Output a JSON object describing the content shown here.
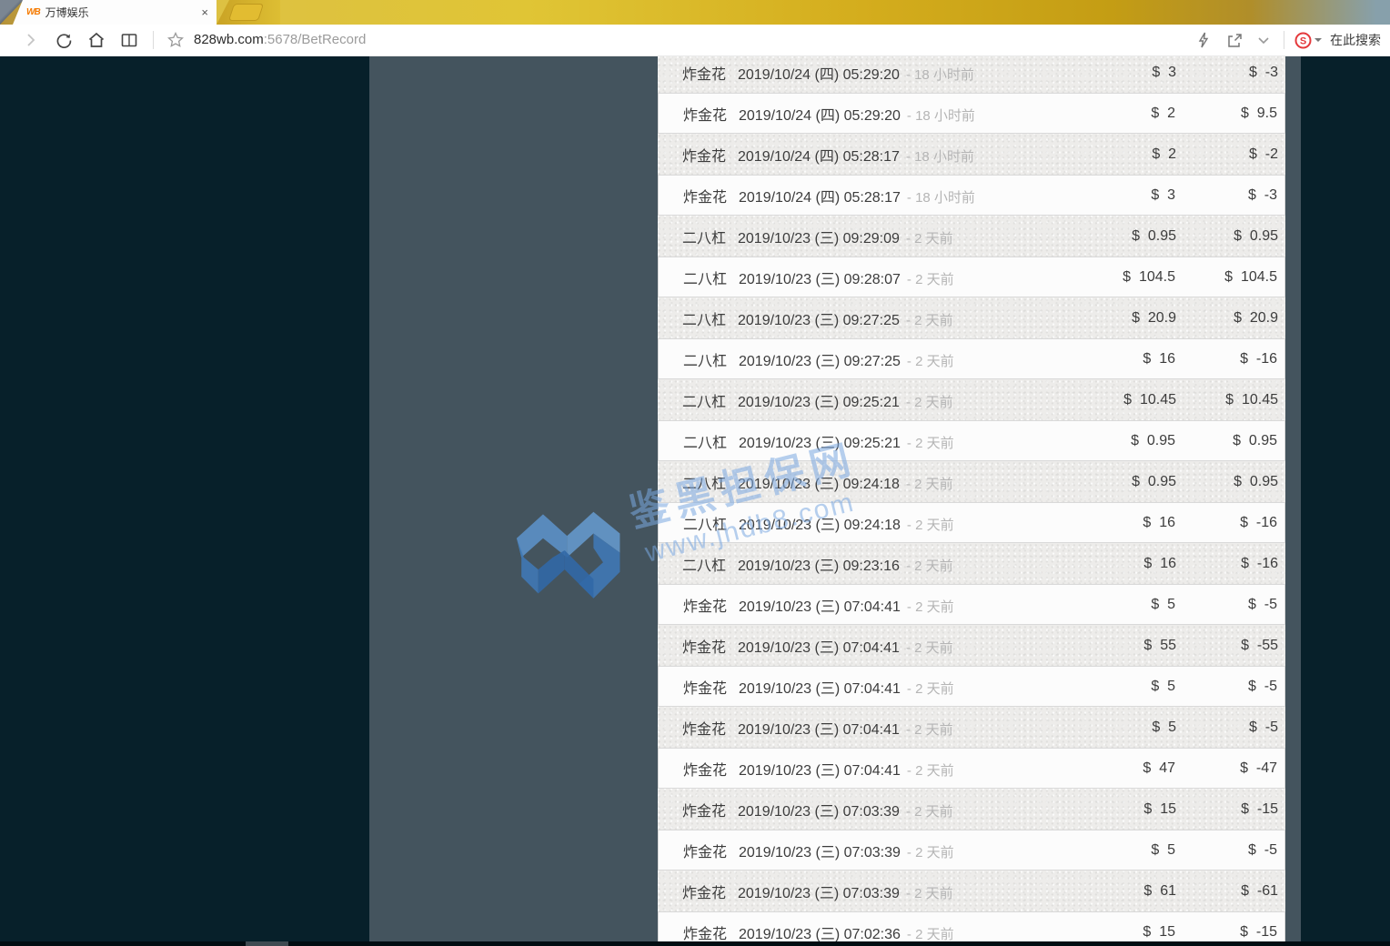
{
  "browser": {
    "tab": {
      "title": "万博娱乐",
      "favicon_text": "WB",
      "close_glyph": "×"
    },
    "url": {
      "host": "828wb.com",
      "rest": ":5678/BetRecord"
    },
    "search": {
      "label": "在此搜索"
    }
  },
  "watermark": {
    "line1": "鉴黑担保网",
    "line2": "www.jhdb8.com"
  },
  "records": {
    "rows": [
      {
        "game": "炸金花",
        "date": "2019/10/24 (四) 05:29:20",
        "ago": "- 18 小时前",
        "bet": "$  3",
        "win": "$  -3"
      },
      {
        "game": "炸金花",
        "date": "2019/10/24 (四) 05:29:20",
        "ago": "- 18 小时前",
        "bet": "$  2",
        "win": "$  9.5"
      },
      {
        "game": "炸金花",
        "date": "2019/10/24 (四) 05:28:17",
        "ago": "- 18 小时前",
        "bet": "$  2",
        "win": "$  -2"
      },
      {
        "game": "炸金花",
        "date": "2019/10/24 (四) 05:28:17",
        "ago": "- 18 小时前",
        "bet": "$  3",
        "win": "$  -3"
      },
      {
        "game": "二八杠",
        "date": "2019/10/23 (三) 09:29:09",
        "ago": "- 2 天前",
        "bet": "$  0.95",
        "win": "$  0.95"
      },
      {
        "game": "二八杠",
        "date": "2019/10/23 (三) 09:28:07",
        "ago": "- 2 天前",
        "bet": "$  104.5",
        "win": "$  104.5"
      },
      {
        "game": "二八杠",
        "date": "2019/10/23 (三) 09:27:25",
        "ago": "- 2 天前",
        "bet": "$  20.9",
        "win": "$  20.9"
      },
      {
        "game": "二八杠",
        "date": "2019/10/23 (三) 09:27:25",
        "ago": "- 2 天前",
        "bet": "$  16",
        "win": "$  -16"
      },
      {
        "game": "二八杠",
        "date": "2019/10/23 (三) 09:25:21",
        "ago": "- 2 天前",
        "bet": "$  10.45",
        "win": "$  10.45"
      },
      {
        "game": "二八杠",
        "date": "2019/10/23 (三) 09:25:21",
        "ago": "- 2 天前",
        "bet": "$  0.95",
        "win": "$  0.95"
      },
      {
        "game": "二八杠",
        "date": "2019/10/23 (三) 09:24:18",
        "ago": "- 2 天前",
        "bet": "$  0.95",
        "win": "$  0.95"
      },
      {
        "game": "二八杠",
        "date": "2019/10/23 (三) 09:24:18",
        "ago": "- 2 天前",
        "bet": "$  16",
        "win": "$  -16"
      },
      {
        "game": "二八杠",
        "date": "2019/10/23 (三) 09:23:16",
        "ago": "- 2 天前",
        "bet": "$  16",
        "win": "$  -16"
      },
      {
        "game": "炸金花",
        "date": "2019/10/23 (三) 07:04:41",
        "ago": "- 2 天前",
        "bet": "$  5",
        "win": "$  -5"
      },
      {
        "game": "炸金花",
        "date": "2019/10/23 (三) 07:04:41",
        "ago": "- 2 天前",
        "bet": "$  55",
        "win": "$  -55"
      },
      {
        "game": "炸金花",
        "date": "2019/10/23 (三) 07:04:41",
        "ago": "- 2 天前",
        "bet": "$  5",
        "win": "$  -5"
      },
      {
        "game": "炸金花",
        "date": "2019/10/23 (三) 07:04:41",
        "ago": "- 2 天前",
        "bet": "$  5",
        "win": "$  -5"
      },
      {
        "game": "炸金花",
        "date": "2019/10/23 (三) 07:04:41",
        "ago": "- 2 天前",
        "bet": "$  47",
        "win": "$  -47"
      },
      {
        "game": "炸金花",
        "date": "2019/10/23 (三) 07:03:39",
        "ago": "- 2 天前",
        "bet": "$  15",
        "win": "$  -15"
      },
      {
        "game": "炸金花",
        "date": "2019/10/23 (三) 07:03:39",
        "ago": "- 2 天前",
        "bet": "$  5",
        "win": "$  -5"
      },
      {
        "game": "炸金花",
        "date": "2019/10/23 (三) 07:03:39",
        "ago": "- 2 天前",
        "bet": "$  61",
        "win": "$  -61"
      },
      {
        "game": "炸金花",
        "date": "2019/10/23 (三) 07:02:36",
        "ago": "- 2 天前",
        "bet": "$  15",
        "win": "$  -15"
      }
    ]
  },
  "colors": {
    "skin_gold": "#d4ad1d",
    "page_dark": "#07202a",
    "panel_slate": "#44545e",
    "watermark_blue": "#7aa8e0",
    "sogou_red": "#e4393c"
  }
}
